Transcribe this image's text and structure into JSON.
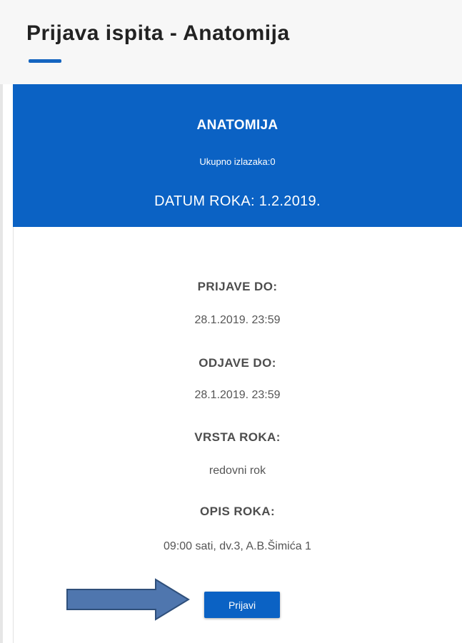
{
  "page": {
    "title": "Prijava ispita - Anatomija"
  },
  "exam": {
    "subject": "ANATOMIJA",
    "attempts_text": "Ukupno izlazaka:0",
    "date_text": "DATUM ROKA: 1.2.2019."
  },
  "details": [
    {
      "label": "PRIJAVE DO:",
      "value": "28.1.2019. 23:59"
    },
    {
      "label": "ODJAVE DO:",
      "value": "28.1.2019. 23:59"
    },
    {
      "label": "VRSTA ROKA:",
      "value": "redovni rok"
    },
    {
      "label": "OPIS ROKA:",
      "value": "09:00 sati, dv.3, A.B.Šimića 1"
    }
  ],
  "actions": {
    "submit_label": "Prijavi"
  },
  "colors": {
    "accent": "#0b62c4",
    "arrow_fill": "#4f76ae",
    "arrow_stroke": "#2f4f7a"
  }
}
